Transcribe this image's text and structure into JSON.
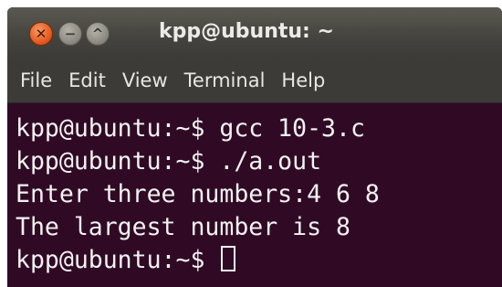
{
  "window": {
    "title": "kpp@ubuntu: ~",
    "buttons": {
      "close_symbol": "✕",
      "minimize_symbol": "−",
      "maximize_symbol": "^"
    }
  },
  "menu": [
    "File",
    "Edit",
    "View",
    "Terminal",
    "Help"
  ],
  "terminal": {
    "lines": [
      "kpp@ubuntu:~$ gcc 10-3.c",
      "kpp@ubuntu:~$ ./a.out",
      "Enter three numbers:4 6 8",
      "The largest number is 8"
    ],
    "prompt": "kpp@ubuntu:~$ "
  },
  "colors": {
    "terminal_bg": "#300a24",
    "terminal_text": "#f2f2f2",
    "titlebar": "#3c3b37",
    "close_button": "#e2571b"
  },
  "icons": [
    "close-icon",
    "minimize-icon",
    "maximize-icon"
  ]
}
